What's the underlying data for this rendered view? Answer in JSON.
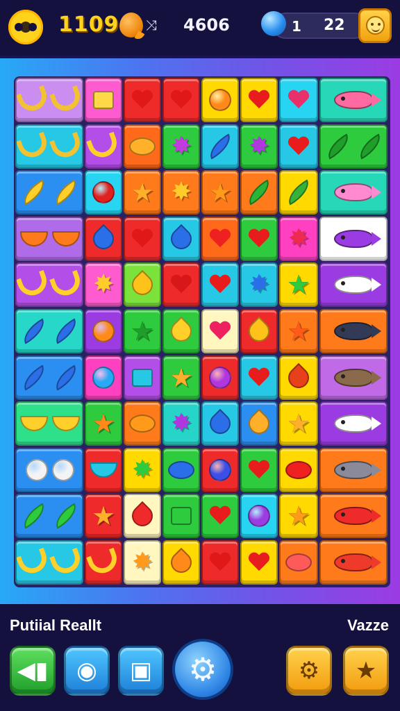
{
  "header": {
    "score": "1109",
    "moves": "4606",
    "arrow_glyph": "⤨",
    "gems": "1",
    "coins": "22"
  },
  "icons": {
    "logo": "flower-logo-icon",
    "currency": "orange-fruit-icon",
    "gem": "blue-orb-icon",
    "profile": "smiley-face-icon"
  },
  "colors": {
    "topbar": "#14113e",
    "score_text": "#ffd21c",
    "board_gradient_left": "#27a9f6",
    "board_gradient_right": "#9b3ce2"
  },
  "board": {
    "rows": [
      [
        {
          "bg": "#c98ef0",
          "ic": "banana",
          "c": "#f2c230",
          "wide": true
        },
        {
          "bg": "#ff5bd0",
          "ic": "square",
          "c": "#ffd84a"
        },
        {
          "bg": "#ee2a2a",
          "ic": "heart",
          "c": "#e01818"
        },
        {
          "bg": "#ee2a2a",
          "ic": "heart",
          "c": "#e01818"
        },
        {
          "bg": "#ffd900",
          "ic": "circle",
          "c": "#ff8a1a"
        },
        {
          "bg": "#ffd900",
          "ic": "heart",
          "c": "#e81c1c"
        },
        {
          "bg": "#27d4f2",
          "ic": "heart",
          "c": "#e8306a"
        },
        {
          "bg": "#27d8b8",
          "ic": "fish",
          "c": "#ff6aa0",
          "wide": true
        }
      ],
      [
        {
          "bg": "#27c8e6",
          "ic": "banana",
          "c": "#f2c230",
          "wide": true
        },
        {
          "bg": "#b34ee8",
          "ic": "banana",
          "c": "#ffcf2a"
        },
        {
          "bg": "#ff6a1a",
          "ic": "oval",
          "c": "#ffb12a"
        },
        {
          "bg": "#2ecb3e",
          "ic": "burst",
          "c": "#c23ae0"
        },
        {
          "bg": "#27c8e6",
          "ic": "leaf",
          "c": "#2a6ee8"
        },
        {
          "bg": "#2ecb3e",
          "ic": "burst",
          "c": "#b036e0"
        },
        {
          "bg": "#27c8e6",
          "ic": "heart",
          "c": "#e81c1c"
        },
        {
          "bg": "#2ecb3e",
          "ic": "leaf",
          "c": "#1f9e2a",
          "wide": true
        }
      ],
      [
        {
          "bg": "#2a8ff0",
          "ic": "leaf",
          "c": "#ffcf2a",
          "wide": true
        },
        {
          "bg": "#27d4f2",
          "ic": "circle",
          "c": "#e22020"
        },
        {
          "bg": "#ff7a1a",
          "ic": "star",
          "c": "#ffb02a"
        },
        {
          "bg": "#ff7a1a",
          "ic": "burst",
          "c": "#ffcc2a"
        },
        {
          "bg": "#ff7a1a",
          "ic": "star",
          "c": "#ff9a1a"
        },
        {
          "bg": "#ff7a1a",
          "ic": "leaf",
          "c": "#2bb436"
        },
        {
          "bg": "#ffd900",
          "ic": "leaf",
          "c": "#36b23a"
        },
        {
          "bg": "#27d8b8",
          "ic": "fish",
          "c": "#ff8ad0",
          "wide": true
        }
      ],
      [
        {
          "bg": "#b06ce8",
          "ic": "bowl",
          "c": "#ff7a1a",
          "wide": true
        },
        {
          "bg": "#ee2a2a",
          "ic": "drop",
          "c": "#2a6ee8"
        },
        {
          "bg": "#ee2a2a",
          "ic": "heart",
          "c": "#e01818"
        },
        {
          "bg": "#27c8e6",
          "ic": "drop",
          "c": "#2a6ee8"
        },
        {
          "bg": "#ff6a1a",
          "ic": "heart",
          "c": "#ee2020"
        },
        {
          "bg": "#2ecb3e",
          "ic": "heart",
          "c": "#e81c1c"
        },
        {
          "bg": "#ff40c0",
          "ic": "burst",
          "c": "#ee2a50"
        },
        {
          "bg": "#ffffff",
          "ic": "fish",
          "c": "#9b3ce2",
          "wide": true
        }
      ],
      [
        {
          "bg": "#b44ee8",
          "ic": "banana",
          "c": "#ffcf2a",
          "wide": true
        },
        {
          "bg": "#ff5bd0",
          "ic": "burst",
          "c": "#ffcc2a"
        },
        {
          "bg": "#7ae23a",
          "ic": "drop",
          "c": "#ffc21a"
        },
        {
          "bg": "#ee2a2a",
          "ic": "heart",
          "c": "#d81818"
        },
        {
          "bg": "#27c8e6",
          "ic": "heart",
          "c": "#e81c1c"
        },
        {
          "bg": "#27c8e6",
          "ic": "burst",
          "c": "#2a6ee8"
        },
        {
          "bg": "#ffd900",
          "ic": "star",
          "c": "#2ecb3e"
        },
        {
          "bg": "#9b3ce2",
          "ic": "fish",
          "c": "#ffffff",
          "wide": true
        }
      ],
      [
        {
          "bg": "#27d8c8",
          "ic": "leaf",
          "c": "#2a6ee8",
          "wide": true
        },
        {
          "bg": "#9b3ce2",
          "ic": "circle",
          "c": "#ff8a1a"
        },
        {
          "bg": "#2ecb3e",
          "ic": "star",
          "c": "#1f9e2a"
        },
        {
          "bg": "#2ecb3e",
          "ic": "drop",
          "c": "#ffcf2a"
        },
        {
          "bg": "#fff6c0",
          "ic": "heart",
          "c": "#ee2060"
        },
        {
          "bg": "#ee2a2a",
          "ic": "drop",
          "c": "#ffc21a"
        },
        {
          "bg": "#ff7a1a",
          "ic": "star",
          "c": "#ff5a1a"
        },
        {
          "bg": "#ff7a1a",
          "ic": "fish",
          "c": "#333a55",
          "wide": true
        }
      ],
      [
        {
          "bg": "#2a8ff0",
          "ic": "leaf",
          "c": "#2a6ee8",
          "wide": true
        },
        {
          "bg": "#ff40c0",
          "ic": "circle",
          "c": "#27a9f6"
        },
        {
          "bg": "#b44ee8",
          "ic": "square",
          "c": "#27c8e6"
        },
        {
          "bg": "#2ecb3e",
          "ic": "star",
          "c": "#ffb02a"
        },
        {
          "bg": "#ee2a2a",
          "ic": "circle",
          "c": "#b036e0"
        },
        {
          "bg": "#27c8e6",
          "ic": "heart",
          "c": "#e81c1c"
        },
        {
          "bg": "#ffd900",
          "ic": "drop",
          "c": "#e8401a"
        },
        {
          "bg": "#c06ae8",
          "ic": "fish",
          "c": "#8a6a4a",
          "wide": true
        }
      ],
      [
        {
          "bg": "#2ee08a",
          "ic": "bowl",
          "c": "#ffcf2a",
          "wide": true
        },
        {
          "bg": "#2ecb3e",
          "ic": "star",
          "c": "#ff8a1a"
        },
        {
          "bg": "#ff7a1a",
          "ic": "oval",
          "c": "#ff9a1a"
        },
        {
          "bg": "#27d4c8",
          "ic": "burst",
          "c": "#b036e0"
        },
        {
          "bg": "#27c8e6",
          "ic": "drop",
          "c": "#2a6ee8"
        },
        {
          "bg": "#2a8ff0",
          "ic": "drop",
          "c": "#ffb02a"
        },
        {
          "bg": "#ffd900",
          "ic": "star",
          "c": "#ffb02a"
        },
        {
          "bg": "#9b3ce2",
          "ic": "fish",
          "c": "#ffffff",
          "wide": true
        }
      ],
      [
        {
          "bg": "#2a8ff0",
          "ic": "circle",
          "c": "#f4f4f4",
          "wide": true
        },
        {
          "bg": "#ee2a2a",
          "ic": "bowl",
          "c": "#27c8e6"
        },
        {
          "bg": "#ffd900",
          "ic": "burst",
          "c": "#2ecb3e"
        },
        {
          "bg": "#2ecb3e",
          "ic": "oval",
          "c": "#2a6ee8"
        },
        {
          "bg": "#ee2a2a",
          "ic": "circle",
          "c": "#3a4ee8"
        },
        {
          "bg": "#2ecb3e",
          "ic": "heart",
          "c": "#e81c1c"
        },
        {
          "bg": "#ffd900",
          "ic": "oval",
          "c": "#ee2020"
        },
        {
          "bg": "#ff7a1a",
          "ic": "fish",
          "c": "#8a8a9a",
          "wide": true
        }
      ],
      [
        {
          "bg": "#2a8ff0",
          "ic": "leaf",
          "c": "#2ecb3e",
          "wide": true
        },
        {
          "bg": "#ee2a2a",
          "ic": "star",
          "c": "#ffb02a"
        },
        {
          "bg": "#fff6c0",
          "ic": "drop",
          "c": "#ee2a2a"
        },
        {
          "bg": "#2ecb3e",
          "ic": "square",
          "c": "#2ecb3e"
        },
        {
          "bg": "#2ecb3e",
          "ic": "heart",
          "c": "#e81c1c"
        },
        {
          "bg": "#27d4f2",
          "ic": "circle",
          "c": "#9b3ce2"
        },
        {
          "bg": "#ffd900",
          "ic": "star",
          "c": "#ff9a1a"
        },
        {
          "bg": "#ff7a1a",
          "ic": "fish",
          "c": "#ee2a2a",
          "wide": true
        }
      ],
      [
        {
          "bg": "#27c8e6",
          "ic": "banana",
          "c": "#ffcf2a",
          "wide": true
        },
        {
          "bg": "#ee2a2a",
          "ic": "banana",
          "c": "#ffcf2a"
        },
        {
          "bg": "#fff6c0",
          "ic": "burst",
          "c": "#ff9a1a"
        },
        {
          "bg": "#ffd900",
          "ic": "drop",
          "c": "#ff8a1a"
        },
        {
          "bg": "#ee2a2a",
          "ic": "heart",
          "c": "#e01818"
        },
        {
          "bg": "#ffd900",
          "ic": "heart",
          "c": "#e81c1c"
        },
        {
          "bg": "#ff7a1a",
          "ic": "oval",
          "c": "#ff5a5a"
        },
        {
          "bg": "#ff7a1a",
          "ic": "fish",
          "c": "#ee3a2a",
          "wide": true
        }
      ]
    ]
  },
  "footer": {
    "left_caption": "Putiial Reallt",
    "right_caption": "Vazze",
    "buttons": [
      {
        "name": "sound-button",
        "icon": "speaker-icon",
        "glyph": "◀▮"
      },
      {
        "name": "camera-button",
        "icon": "camera-icon",
        "glyph": "◉"
      },
      {
        "name": "photo-button",
        "icon": "photo-camera-icon",
        "glyph": "▣"
      },
      {
        "name": "settings-button",
        "icon": "gear-icon",
        "glyph": "⚙"
      },
      {
        "name": "options-button",
        "icon": "gear-icon",
        "glyph": "⚙"
      },
      {
        "name": "favorites-button",
        "icon": "star-icon",
        "glyph": "★"
      }
    ]
  }
}
